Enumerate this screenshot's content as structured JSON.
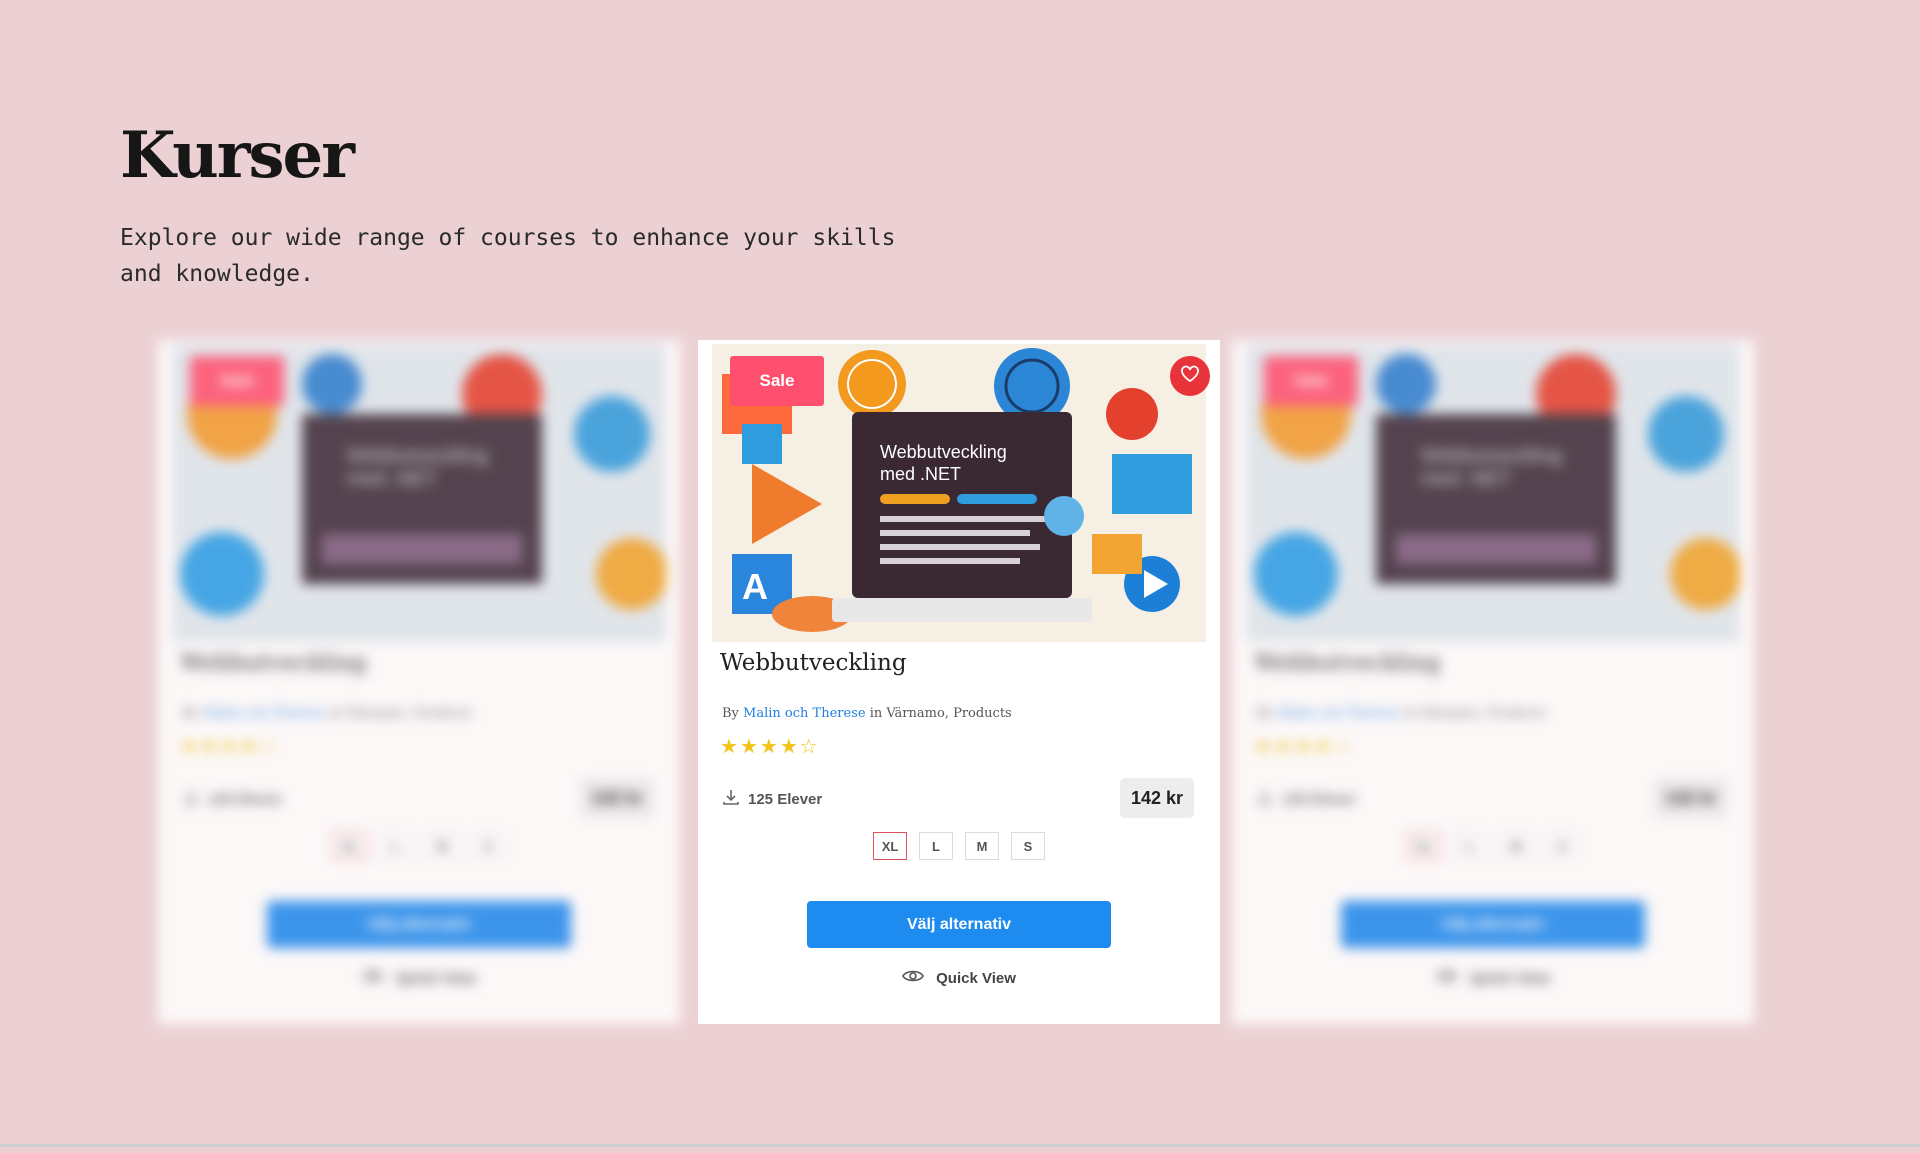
{
  "hero": {
    "title": "Kurser",
    "subtitle": "Explore our wide range of courses to enhance your skills and knowledge."
  },
  "cards": [
    {
      "badge": "Sale",
      "image_caption_line1": "Webbutveckling",
      "image_caption_line2": "med .NET",
      "title": "Webbutveckling",
      "by": "By",
      "author": "Malin och Therese",
      "location": "in Värnamo, Products",
      "rating": 4,
      "rating_max": 5,
      "students": "125 Elever",
      "price": "142 kr",
      "sizes": [
        "XL",
        "L",
        "M",
        "S"
      ],
      "selected_size": "XL",
      "choose_label": "Välj alternativ",
      "quick_view_label": "Quick View"
    },
    {
      "badge": "Sale",
      "image_caption_line1": "Webbutveckling",
      "image_caption_line2": "med .NET",
      "title": "Webbutveckling",
      "by": "By",
      "author": "Malin och Therese",
      "location": "in Värnamo, Products",
      "rating": 4,
      "rating_max": 5,
      "students": "125 Elever",
      "price": "142 kr",
      "sizes": [
        "XL",
        "L",
        "M",
        "S"
      ],
      "selected_size": "XL",
      "choose_label": "Välj alternativ",
      "quick_view_label": "Quick View"
    },
    {
      "badge": "Sale",
      "image_caption_line1": "Webbutveckling",
      "image_caption_line2": "med .NET",
      "title": "Webbutveckling",
      "by": "By",
      "author": "Malin och Therese",
      "location": "in Värnamo, Products",
      "rating": 4,
      "rating_max": 5,
      "students": "125 Elever",
      "price": "142 kr",
      "sizes": [
        "XL",
        "L",
        "M",
        "S"
      ],
      "selected_size": "XL",
      "choose_label": "Välj alternativ",
      "quick_view_label": "Quick View"
    }
  ],
  "colors": {
    "page_background": "#ecd1d4",
    "accent_blue": "#1e8bf0",
    "sale_pink": "#ff4f6e",
    "star_yellow": "#f3c318",
    "heart_red": "#e8333a"
  },
  "icons": {
    "download": "download-icon",
    "eye": "eye-icon",
    "heart": "heart-icon",
    "star": "star-icon"
  }
}
